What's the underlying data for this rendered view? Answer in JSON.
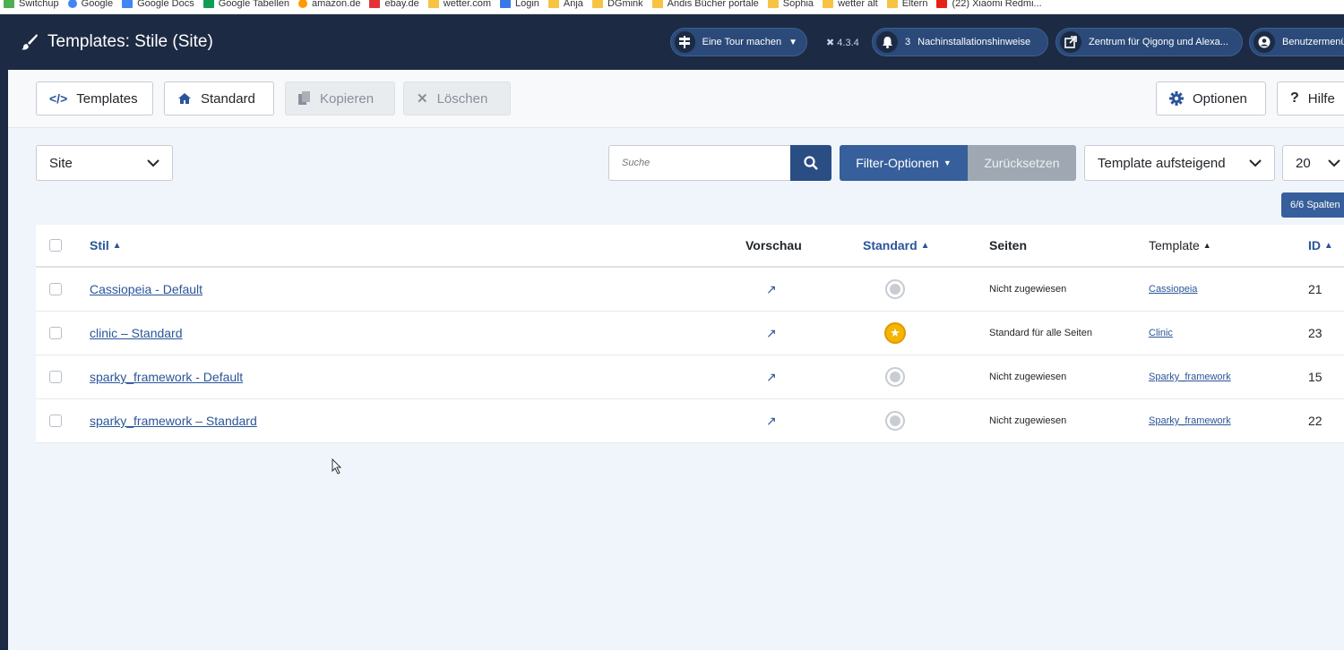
{
  "browser_bookmarks": [
    "Switchup",
    "Google",
    "Google Docs",
    "Google Tabellen",
    "amazon.de",
    "ebay.de",
    "wetter.com",
    "Login",
    "Anja",
    "DGmink",
    "Andis Bücher portale",
    "Sophia",
    "wetter alt",
    "Eltern",
    "(22) Xiaomi Redmi..."
  ],
  "header": {
    "title": "Templates: Stile (Site)",
    "tour_label": "Eine Tour machen",
    "version": "4.3.4",
    "notifications_count": "3",
    "notifications_label": "Nachinstallationshinweise",
    "site_label": "Zentrum für Qigong und Alexa...",
    "user_label": "Benutzermenü"
  },
  "toolbar": {
    "templates_label": "Templates",
    "standard_label": "Standard",
    "copy_label": "Kopieren",
    "delete_label": "Löschen",
    "options_label": "Optionen",
    "help_label": "Hilfe"
  },
  "filters": {
    "client_value": "Site",
    "search_placeholder": "Suche",
    "filter_options_label": "Filter-Optionen",
    "reset_label": "Zurücksetzen",
    "sort_value": "Template aufsteigend",
    "limit_value": "20",
    "columns_label": "6/6 Spalten"
  },
  "table": {
    "headers": {
      "style": "Stil",
      "preview": "Vorschau",
      "standard": "Standard",
      "pages": "Seiten",
      "template": "Template",
      "id": "ID"
    },
    "rows": [
      {
        "style": "Cassiopeia - Default",
        "default": false,
        "pages": "Nicht zugewiesen",
        "template": "Cassiopeia",
        "id": "21"
      },
      {
        "style": "clinic – Standard",
        "default": true,
        "pages": "Standard für alle Seiten",
        "template": "Clinic",
        "id": "23"
      },
      {
        "style": "sparky_framework - Default",
        "default": false,
        "pages": "Nicht zugewiesen",
        "template": "Sparky_framework",
        "id": "15"
      },
      {
        "style": "sparky_framework – Standard",
        "default": false,
        "pages": "Nicht zugewiesen",
        "template": "Sparky_framework",
        "id": "22"
      }
    ]
  },
  "colors": {
    "header_bg": "#1c2b43",
    "primary": "#2a4e84",
    "link": "#2a5599",
    "star": "#f4b400"
  }
}
